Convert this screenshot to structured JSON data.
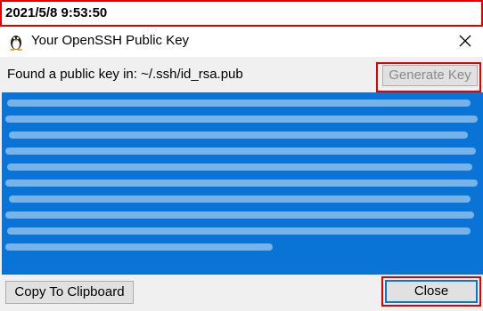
{
  "timestamp": "2021/5/8 9:53:50",
  "window": {
    "title": "Your OpenSSH Public Key",
    "icon": "penguin-app-icon",
    "close_icon": "close-icon"
  },
  "key_info": {
    "found_label": "Found a public key in: ~/.ssh/id_rsa.pub",
    "generate_label": "Generate Key",
    "generate_enabled": false
  },
  "key_text_area": {
    "content_state": "blurred-redacted",
    "selection_color": "#0a74d6"
  },
  "footer": {
    "copy_label": "Copy To Clipboard",
    "close_label": "Close"
  },
  "colors": {
    "highlight_border": "#e00000",
    "accent": "#0078d7"
  }
}
